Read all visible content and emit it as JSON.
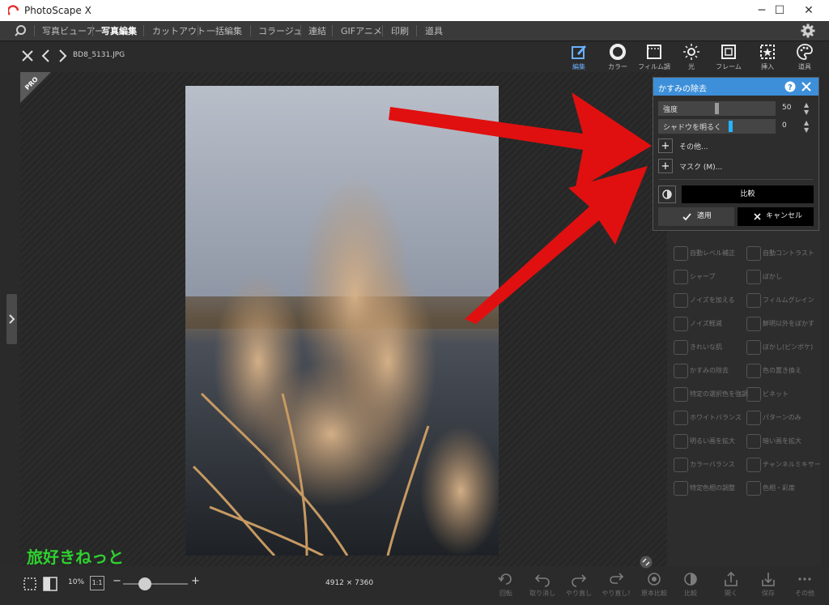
{
  "app": {
    "title": "PhotoScape X",
    "brand_color": "#3d8fd9"
  },
  "window_controls": [
    "─",
    "☐",
    "✕"
  ],
  "menu": {
    "search_icon": "search-icon",
    "items": [
      "写真ビューアー",
      "写真編集",
      "カットアウト",
      "一括編集",
      "コラージュ",
      "連結",
      "GIFアニメ",
      "印刷",
      "道具"
    ],
    "active_index": 1,
    "settings_icon": "gear-icon"
  },
  "toolbar": {
    "filename": "BD8_5131.JPG",
    "tools": [
      {
        "label": "編集",
        "icon": "edit-icon"
      },
      {
        "label": "カラー",
        "icon": "color-ring-icon"
      },
      {
        "label": "フィルム調",
        "icon": "film-icon"
      },
      {
        "label": "光",
        "icon": "sun-icon"
      },
      {
        "label": "フレーム",
        "icon": "frame-icon"
      },
      {
        "label": "挿入",
        "icon": "insert-star-icon"
      },
      {
        "label": "道具",
        "icon": "palette-icon"
      }
    ],
    "active_index": 0
  },
  "pro_badge": "PRO",
  "right_panel": {
    "items": [
      "自動レベル補正",
      "自動コントラスト",
      "シャープ",
      "ぼかし",
      "ノイズを加える",
      "フィルムグレイン",
      "ノイズ軽減",
      "鮮明以外をぼかす",
      "きれいな肌",
      "ぼかし(ピンボケ)",
      "かすみの除去",
      "色の置き換え",
      "特定の選択色を強調",
      "ビネット",
      "ホワイトバランス",
      "パターンのみ",
      "明るい画を拡大",
      "暗い画を拡大",
      "カラーバランス",
      "チャンネルミキサー",
      "特定色相の調整",
      "色相・彩度"
    ]
  },
  "dialog": {
    "title": "かすみの除去",
    "help_icon": "help-icon",
    "close_icon": "close-icon",
    "sliders": [
      {
        "label": "強度",
        "value": "50",
        "fraction": 0.5,
        "thumb_color": "#9a9a9a"
      },
      {
        "label": "シャドウを明るく",
        "value": "0",
        "fraction": 0.62,
        "thumb_color": "#25b5ff"
      }
    ],
    "expanders": [
      "その他...",
      "マスク (M)..."
    ],
    "compare_label": "比較",
    "apply_label": "適用",
    "cancel_label": "キャンセル"
  },
  "statusbar": {
    "zoom": "10%",
    "one_to_one": "1:1",
    "dimensions": "4912 × 7360",
    "zoom_fraction": 0.2,
    "buttons": [
      "回転",
      "取り消し",
      "やり直し",
      "やり直し!",
      "原本比較",
      "比較",
      "開く",
      "保存",
      "その他"
    ]
  },
  "watermark": "旅好きねっと",
  "arrow_color": "#e01010"
}
